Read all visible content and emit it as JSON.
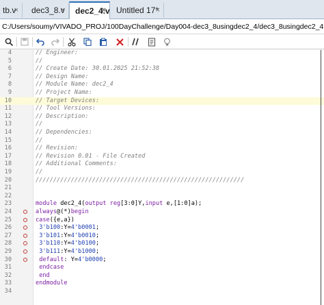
{
  "tabs": [
    {
      "label": "tb.v",
      "close": "×"
    },
    {
      "label": "dec3_8.v",
      "close": "×"
    },
    {
      "label": "dec2_4.v",
      "close": "×",
      "active": true
    },
    {
      "label": "Untitled 17*",
      "close": "×"
    }
  ],
  "file_path": "C:/Users/soumy/VIVADO_PROJ/100DayChallenge/Day004-dec3_8usingdec2_4/dec3_8usingdec2_4.srcs/sources_1/new/dec2_4.v",
  "toolbar": {
    "icons": [
      "search-icon",
      "save-icon",
      "undo-icon",
      "redo-icon",
      "cut-icon",
      "copy-icon",
      "paste-icon",
      "delete-icon",
      "comment-icon",
      "template-icon",
      "lightbulb-icon"
    ]
  },
  "lines": [
    {
      "num": "4",
      "text": "// Engineer:"
    },
    {
      "num": "5",
      "text": "//"
    },
    {
      "num": "6",
      "text": "// Create Date: 30.01.2025 21:52:38"
    },
    {
      "num": "7",
      "text": "// Design Name:"
    },
    {
      "num": "8",
      "text": "// Module Name: dec2_4"
    },
    {
      "num": "9",
      "text": "// Project Name:"
    },
    {
      "num": "10",
      "text": "// Target Devices:"
    },
    {
      "num": "11",
      "text": "// Tool Versions:"
    },
    {
      "num": "12",
      "text": "// Description:"
    },
    {
      "num": "13",
      "text": "//"
    },
    {
      "num": "14",
      "text": "// Dependencies:"
    },
    {
      "num": "15",
      "text": "//"
    },
    {
      "num": "16",
      "text": "// Revision:"
    },
    {
      "num": "17",
      "text": "// Revision 0.01 - File Created"
    },
    {
      "num": "18",
      "text": "// Additional Comments:"
    },
    {
      "num": "19",
      "text": "//"
    },
    {
      "num": "20",
      "text": "///////////////////////////////////////////////////////////"
    },
    {
      "num": "21",
      "text": ""
    },
    {
      "num": "22",
      "text": ""
    },
    {
      "num": "23",
      "text": "module dec2_4(output reg[3:0]Y,input e,[1:0]a);"
    },
    {
      "num": "24",
      "text": "always@(*)begin"
    },
    {
      "num": "25",
      "text": "case({e,a})"
    },
    {
      "num": "26",
      "text": " 3'b100:Y=4'b0001;"
    },
    {
      "num": "27",
      "text": " 3'b101:Y=4'b0010;"
    },
    {
      "num": "28",
      "text": " 3'b110:Y=4'b0100;"
    },
    {
      "num": "29",
      "text": " 3'b111:Y=4'b1000;"
    },
    {
      "num": "30",
      "text": " default: Y=4'b0000;"
    },
    {
      "num": "31",
      "text": " endcase"
    },
    {
      "num": "32",
      "text": " end"
    },
    {
      "num": "33",
      "text": "endmodule"
    },
    {
      "num": "34",
      "text": ""
    }
  ],
  "colors": {
    "comment": "#7f7f7f",
    "keyword": "#7b1fa2",
    "number": "#1f3fb0",
    "highlight_line": "#fdfbd8",
    "active_tab_accent": "#2f6fb5"
  }
}
